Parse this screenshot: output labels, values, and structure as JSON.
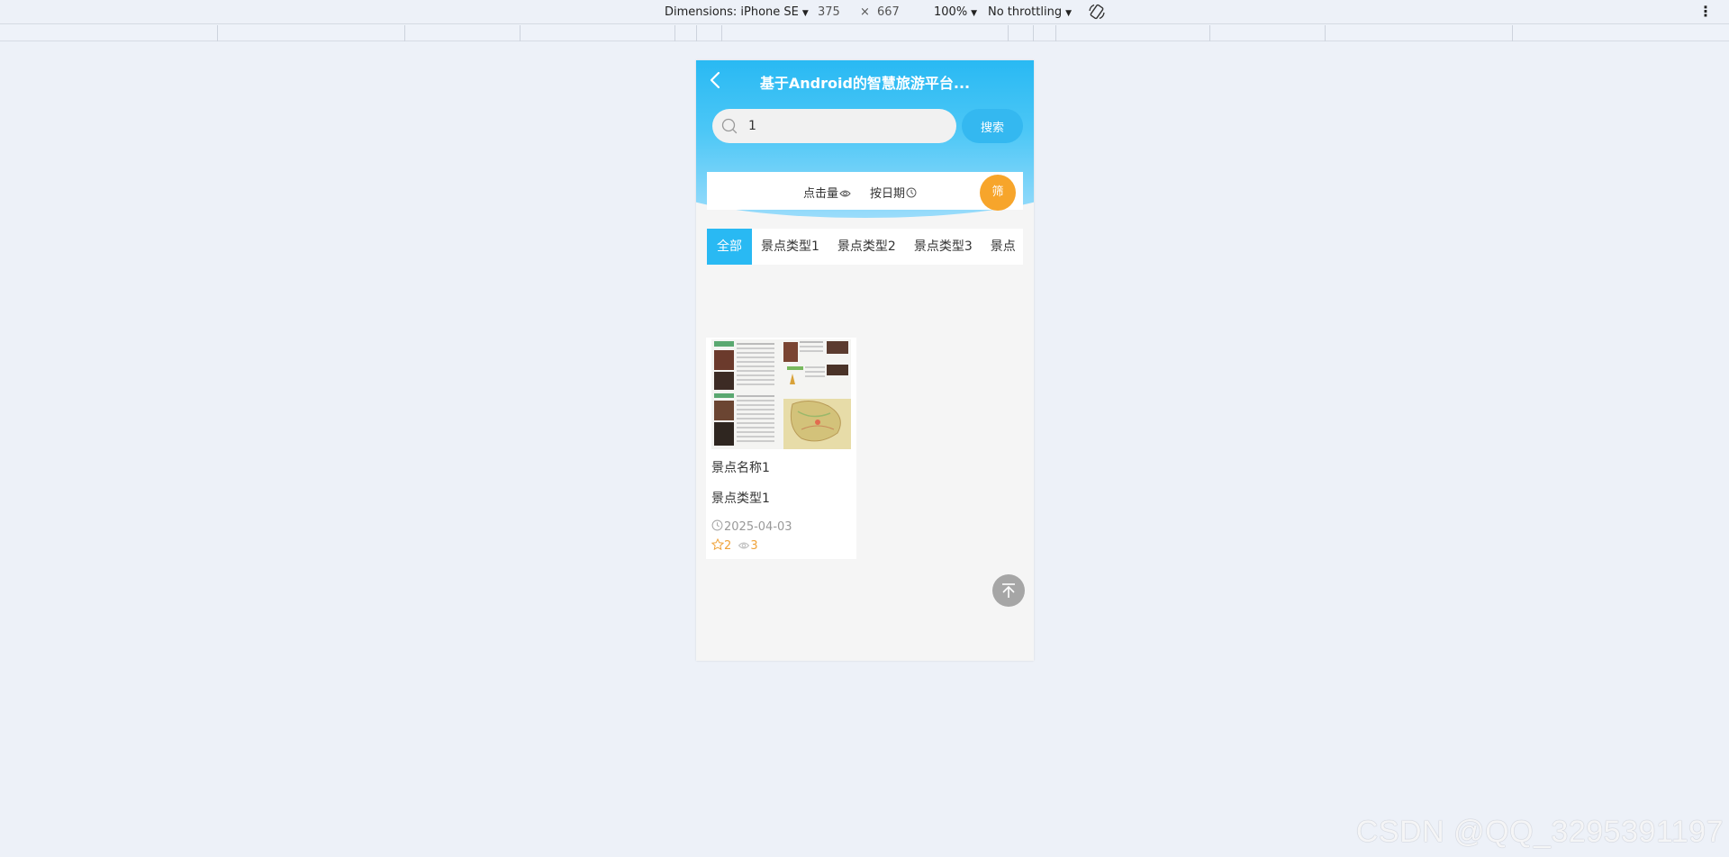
{
  "devtools": {
    "dimensions_label": "Dimensions: iPhone SE",
    "width": "375",
    "times": "×",
    "height": "667",
    "zoom": "100%",
    "throttling": "No throttling"
  },
  "app": {
    "title": "基于Android的智慧旅游平台...",
    "search": {
      "value": "1",
      "button_label": "搜索"
    },
    "sort": {
      "clicks_label": "点击量",
      "date_label": "按日期",
      "filter_label": "筛"
    },
    "tabs": [
      {
        "label": "全部",
        "active": true
      },
      {
        "label": "景点类型1",
        "active": false
      },
      {
        "label": "景点类型2",
        "active": false
      },
      {
        "label": "景点类型3",
        "active": false
      },
      {
        "label": "景点",
        "active": false
      }
    ],
    "items": [
      {
        "name": "景点名称1",
        "type": "景点类型1",
        "date": "2025-04-03",
        "stars": "2",
        "views": "3"
      }
    ]
  },
  "colors": {
    "primary": "#29b9f3",
    "accent": "#f7a52b",
    "page_bg": "#edf1f8"
  },
  "watermark": "CSDN @QQ_3295391197"
}
